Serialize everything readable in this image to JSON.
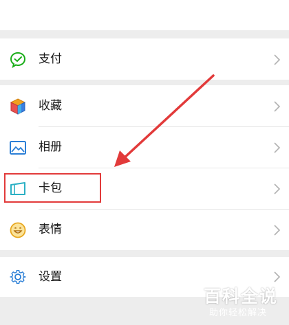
{
  "menu": {
    "items": [
      {
        "label": "支付",
        "icon": "wechat-pay-icon"
      },
      {
        "label": "收藏",
        "icon": "favorites-cube-icon"
      },
      {
        "label": "相册",
        "icon": "album-picture-icon"
      },
      {
        "label": "卡包",
        "icon": "card-wallet-icon"
      },
      {
        "label": "表情",
        "icon": "smiley-face-icon"
      },
      {
        "label": "设置",
        "icon": "settings-gear-icon"
      }
    ]
  },
  "watermark": {
    "brand": "百科全说",
    "slogan": "助你轻松解决"
  },
  "colors": {
    "accent_green": "#1aad19",
    "annotation_red": "#e23a3a",
    "background": "#ededed"
  }
}
